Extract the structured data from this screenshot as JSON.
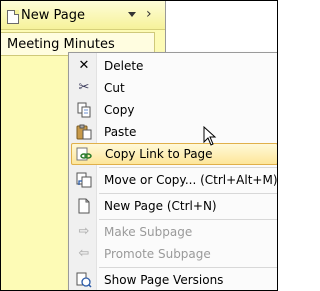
{
  "pane": {
    "new_page_label": "New Page",
    "page_tab_label": "Meeting Minutes"
  },
  "menu": {
    "items": [
      {
        "label": "Delete",
        "icon": "close-icon"
      },
      {
        "label": "Cut",
        "icon": "scissors-icon"
      },
      {
        "label": "Copy",
        "icon": "copy-icon"
      },
      {
        "label": "Paste",
        "icon": "paste-icon"
      },
      {
        "label": "Copy Link to Page",
        "icon": "link-icon"
      },
      {
        "label": "Move or Copy... (Ctrl+Alt+M)",
        "icon": "move-icon"
      },
      {
        "label": "New Page (Ctrl+N)",
        "icon": "new-page-icon"
      },
      {
        "label": "Make Subpage",
        "icon": "indent-icon"
      },
      {
        "label": "Promote Subpage",
        "icon": "outdent-icon"
      },
      {
        "label": "Show Page Versions",
        "icon": "versions-icon"
      }
    ],
    "hovered_item": "Copy Link to Page"
  },
  "colors": {
    "pane_background": "#fdfbb6",
    "hover_background": "#fde69a",
    "hover_border": "#e0b04a",
    "disabled_text": "#9a9a9a"
  }
}
